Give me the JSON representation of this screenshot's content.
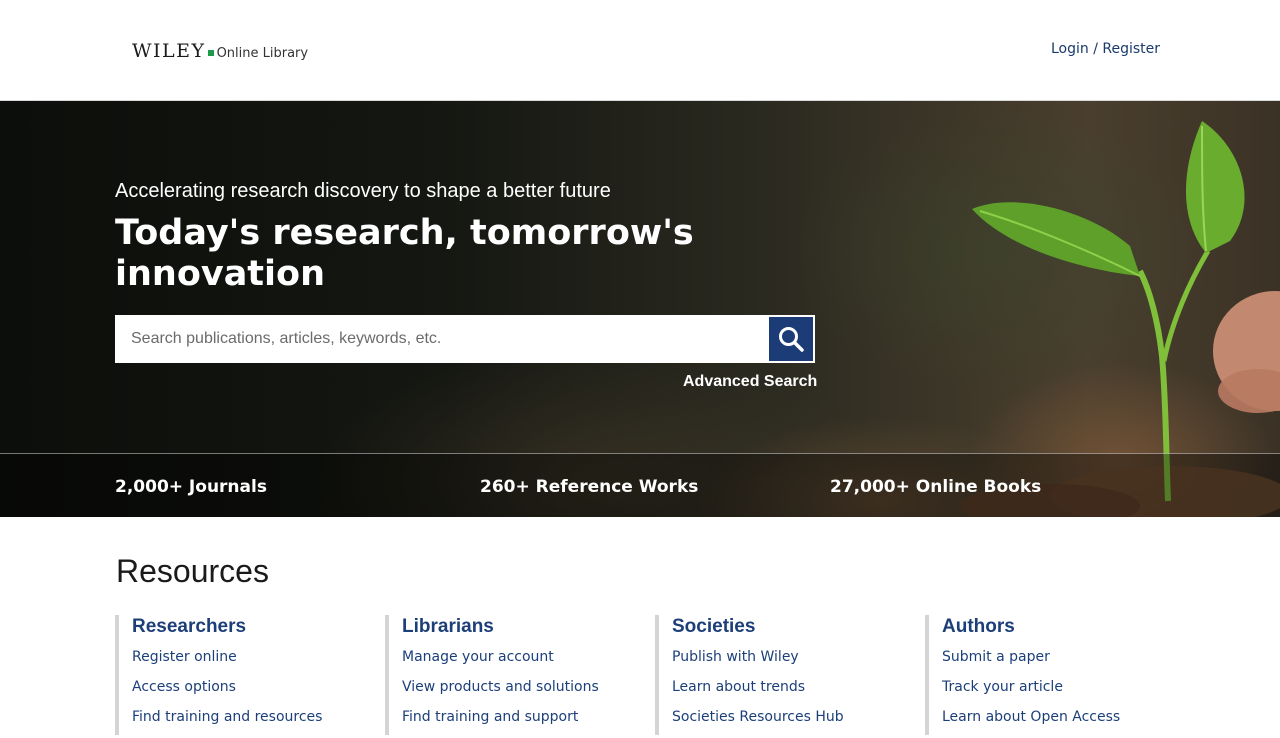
{
  "header": {
    "logo_brand": "WILEY",
    "logo_product": "Online Library",
    "login_label": "Login / Register"
  },
  "hero": {
    "subtitle": "Accelerating research discovery to shape a better future",
    "title": "Today's research, tomorrow's innovation",
    "search": {
      "placeholder": "Search publications, articles, keywords, etc.",
      "value": ""
    },
    "advanced_search_label": "Advanced Search",
    "stats": [
      {
        "label": "2,000+ Journals"
      },
      {
        "label": "260+ Reference Works"
      },
      {
        "label": "27,000+ Online Books"
      }
    ]
  },
  "resources": {
    "title": "Resources",
    "columns": [
      {
        "heading": "Researchers",
        "links": [
          "Register online",
          "Access options",
          "Find training and resources"
        ]
      },
      {
        "heading": "Librarians",
        "links": [
          "Manage your account",
          "View products and solutions",
          "Find training and support"
        ]
      },
      {
        "heading": "Societies",
        "links": [
          "Publish with Wiley",
          "Learn about trends",
          "Societies Resources Hub"
        ]
      },
      {
        "heading": "Authors",
        "links": [
          "Submit a paper",
          "Track your article",
          "Learn about Open Access"
        ]
      }
    ]
  },
  "icons": {
    "search": "search-icon",
    "logo_mark": "green-square-icon"
  },
  "colors": {
    "brand_navy": "#1b3c77",
    "link_blue": "#1c3f79",
    "logo_green": "#1e9b4a"
  }
}
